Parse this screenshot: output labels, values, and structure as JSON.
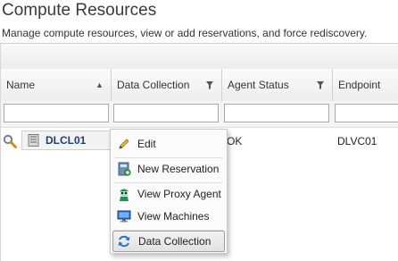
{
  "page": {
    "title": "Compute Resources",
    "subtitle": "Manage compute resources, view or add reservations, and force rediscovery."
  },
  "grid": {
    "columns": [
      {
        "label": "Name",
        "icon": "sort-ascending-icon"
      },
      {
        "label": "Data Collection",
        "icon": "filter-icon"
      },
      {
        "label": "Agent Status",
        "icon": "filter-icon"
      },
      {
        "label": "Endpoint",
        "icon": ""
      }
    ],
    "rows": [
      {
        "name": "DLCL01",
        "agent_status": "OK",
        "endpoint": "DLVC01"
      }
    ]
  },
  "context_menu": {
    "items": [
      {
        "label": "Edit",
        "icon": "pencil-icon"
      },
      {
        "label": "New Reservation",
        "icon": "new-reservation-icon"
      },
      {
        "label": "View Proxy Agent",
        "icon": "proxy-agent-icon"
      },
      {
        "label": "View Machines",
        "icon": "monitor-icon"
      },
      {
        "label": "Data Collection",
        "icon": "refresh-icon",
        "highlighted": true
      }
    ]
  },
  "colors": {
    "accent": "#1f3f74",
    "header_bg": "#ededed",
    "menu_highlight": "#e2e2e2"
  }
}
